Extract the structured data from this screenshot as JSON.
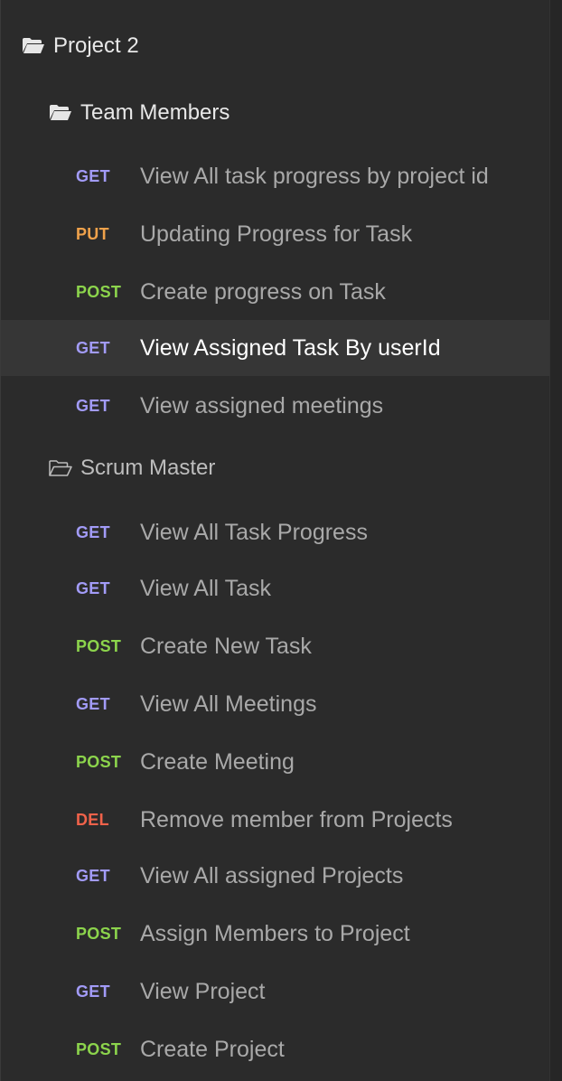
{
  "tree": {
    "project": {
      "label": "Project 2",
      "icon": "folder-open-icon"
    },
    "folders": [
      {
        "label": "Team Members",
        "icon": "folder-open-icon",
        "requests": [
          {
            "method": "GET",
            "label": "View All task progress by project id",
            "active": false
          },
          {
            "method": "PUT",
            "label": "Updating Progress for Task",
            "active": false
          },
          {
            "method": "POST",
            "label": "Create progress on Task",
            "active": false
          },
          {
            "method": "GET",
            "label": "View Assigned Task By userId",
            "active": true
          },
          {
            "method": "GET",
            "label": "View assigned meetings",
            "active": false
          }
        ]
      },
      {
        "label": "Scrum Master",
        "icon": "folder-outline-icon",
        "requests": [
          {
            "method": "GET",
            "label": "View All Task Progress",
            "active": false
          },
          {
            "method": "GET",
            "label": "View All Task",
            "active": false
          },
          {
            "method": "POST",
            "label": "Create New Task",
            "active": false
          },
          {
            "method": "GET",
            "label": "View All Meetings",
            "active": false
          },
          {
            "method": "POST",
            "label": "Create Meeting",
            "active": false
          },
          {
            "method": "DEL",
            "label": "Remove member from Projects",
            "active": false
          },
          {
            "method": "GET",
            "label": "View All assigned Projects",
            "active": false
          },
          {
            "method": "POST",
            "label": "Assign Members to Project",
            "active": false
          },
          {
            "method": "GET",
            "label": "View Project",
            "active": false
          },
          {
            "method": "POST",
            "label": "Create Project",
            "active": false
          }
        ]
      }
    ]
  },
  "colors": {
    "background": "#2b2b2b",
    "active_row": "#363636",
    "get": "#a29bf7",
    "put": "#f0a24b",
    "post": "#8cd44c",
    "del": "#f0624a"
  }
}
